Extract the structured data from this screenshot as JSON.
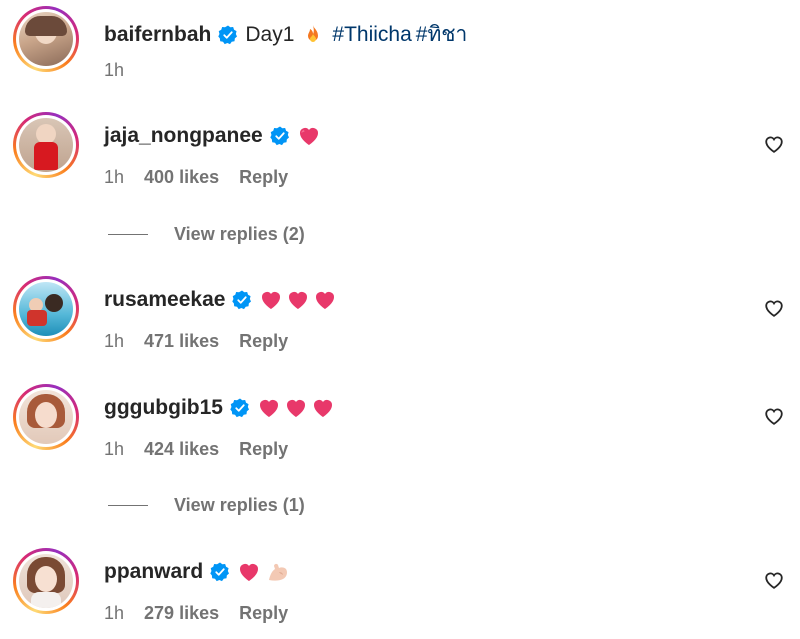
{
  "caption": {
    "username": "baifernbah",
    "text": "Day1",
    "hashtags": [
      "#Thiicha",
      "#ทิชา"
    ],
    "time": "1h",
    "emoji": "fire-emoji"
  },
  "comments": [
    {
      "username": "jaja_nongpanee",
      "emojis": [
        "heart"
      ],
      "time": "1h",
      "likes": "400 likes",
      "reply": "Reply",
      "view_replies": "View replies (2)"
    },
    {
      "username": "rusameekae",
      "emojis": [
        "heart",
        "heart",
        "heart"
      ],
      "time": "1h",
      "likes": "471 likes",
      "reply": "Reply"
    },
    {
      "username": "gggubgib15",
      "emojis": [
        "heart",
        "heart",
        "heart"
      ],
      "time": "1h",
      "likes": "424 likes",
      "reply": "Reply",
      "view_replies": "View replies (1)"
    },
    {
      "username": "ppanward",
      "emojis": [
        "heart",
        "flexed-biceps"
      ],
      "time": "1h",
      "likes": "279 likes",
      "reply": "Reply"
    }
  ],
  "colors": {
    "text": "#262626",
    "secondary": "#737373",
    "hashtag": "#00376b",
    "verified": "#0095f6",
    "heart_emoji": "#e8386a"
  }
}
